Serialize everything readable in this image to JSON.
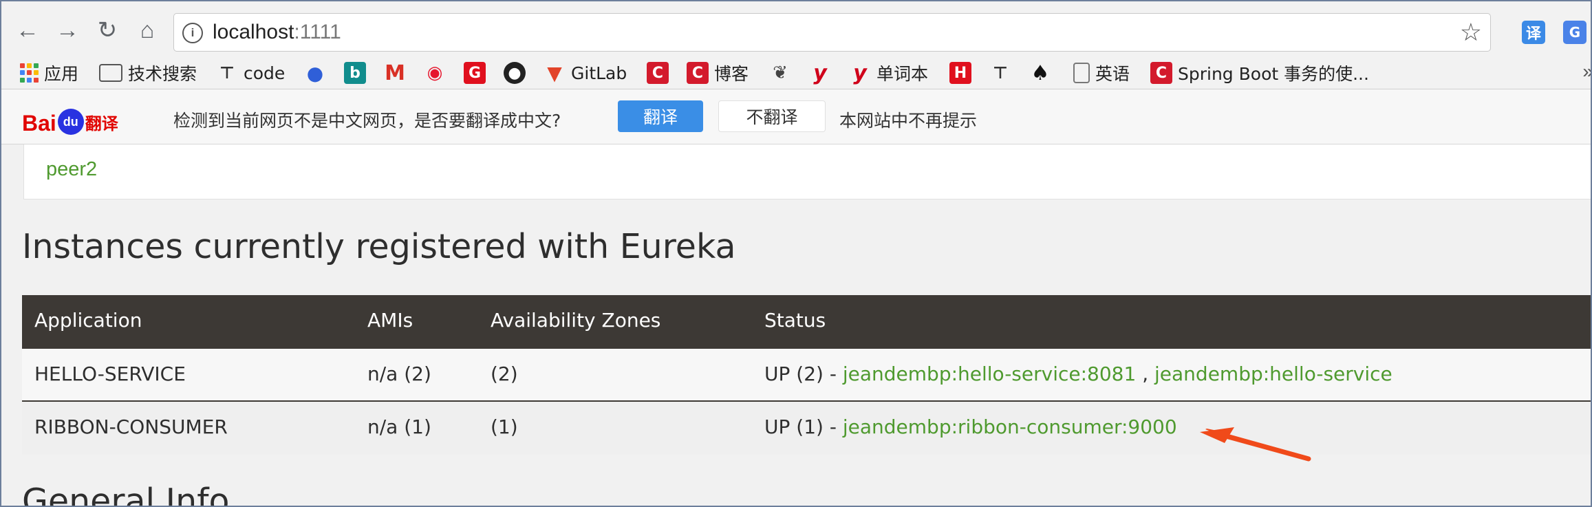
{
  "browser": {
    "url_host": "localhost",
    "url_port": ":1111",
    "ext1_label": "译",
    "ext2_label": "G"
  },
  "bookmarks": {
    "apps": "应用",
    "folder": "技术搜索",
    "code": "code",
    "gitlab": "GitLab",
    "blog": "博客",
    "words": "单词本",
    "english": "英语",
    "spring": "Spring Boot 事务的使...",
    "more": "»"
  },
  "translate_bar": {
    "logo_bai": "Bai",
    "logo_du": "du",
    "logo_fy": "翻译",
    "message": "检测到当前网页不是中文网页，是否要翻译成中文?",
    "translate_button": "翻译",
    "no_translate_button": "不翻译",
    "never_text": "本网站中不再提示"
  },
  "page": {
    "peer_link": "peer2",
    "heading": "Instances currently registered with Eureka",
    "next_heading": "General Info",
    "table": {
      "headers": [
        "Application",
        "AMIs",
        "Availability Zones",
        "Status"
      ],
      "rows": [
        {
          "application": "HELLO-SERVICE",
          "amis": "n/a (2)",
          "zones": "(2)",
          "status_prefix": "UP (2) - ",
          "links": [
            "jeandembp:hello-service:8081",
            "jeandembp:hello-service"
          ],
          "separator": " , "
        },
        {
          "application": "RIBBON-CONSUMER",
          "amis": "n/a (1)",
          "zones": "(1)",
          "status_prefix": "UP (1) - ",
          "links": [
            "jeandembp:ribbon-consumer:9000"
          ]
        }
      ]
    }
  },
  "colors": {
    "link_green": "#4f9a2f",
    "header_dark": "#3d3935",
    "annotation_arrow": "#f04a1a"
  }
}
